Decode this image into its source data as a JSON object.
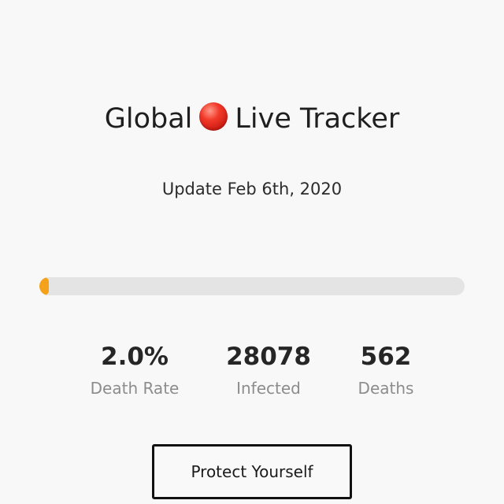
{
  "header": {
    "title_prefix": "Global",
    "title_suffix": "Live Tracker",
    "live_indicator_icon": "red-circle-icon",
    "update_text": "Update Feb 6th, 2020"
  },
  "progress": {
    "value_percent": 2.0,
    "fill_color": "#f5a21a",
    "track_color": "#e4e4e4"
  },
  "stats": [
    {
      "value": "2.0%",
      "label": "Death Rate"
    },
    {
      "value": "28078",
      "label": "Infected"
    },
    {
      "value": "562",
      "label": "Deaths"
    }
  ],
  "actions": {
    "protect_label": "Protect Yourself"
  }
}
